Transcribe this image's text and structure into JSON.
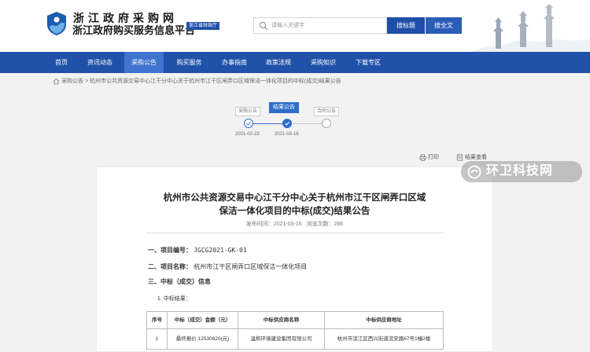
{
  "header": {
    "site_name": "浙江政府采购网",
    "site_subtitle": "浙江政府购买服务信息平台",
    "region_tag": "浙江省财政厅",
    "search_placeholder": "请输入关键字",
    "search_site_label": "搜标题",
    "search_all_label": "搜全文"
  },
  "nav": {
    "items": [
      "首页",
      "资讯动态",
      "采购公告",
      "购买服务",
      "办事指南",
      "政策法规",
      "采购知识",
      "下载专区"
    ],
    "active_index": 2
  },
  "breadcrumb": {
    "root": "采购公告",
    "separator": ">",
    "current": "杭州市公共资源交易中心江干分中心关于杭州市江干区闸弄口区域保洁一体化项目的中标(成交)结果公告"
  },
  "timeline": {
    "steps": [
      {
        "label": "采购公告",
        "date": "2021-02-23",
        "state": "done"
      },
      {
        "label": "结果公告",
        "date": "2021-03-16",
        "state": "current"
      },
      {
        "label": "合同公告",
        "date": "",
        "state": "todo"
      }
    ]
  },
  "tools": {
    "print": "打印",
    "view": "结果查看"
  },
  "article": {
    "title_line1": "杭州市公共资源交易中心江干分中心关于杭州市江干区闸弄口区域",
    "title_line2": "保洁一体化项目的中标(成交)结果公告",
    "publish_label": "发布时间：",
    "publish_date": "2021-03-16",
    "views_label": "浏览次数：",
    "views": "286",
    "sections": [
      {
        "num": "一、",
        "label": "项目编号：",
        "value": "JGCG2021-GK-01"
      },
      {
        "num": "二、",
        "label": "项目名称：",
        "value": "杭州市江干区闸弄口区域保洁一体化项目"
      },
      {
        "num": "三、",
        "label": "中标（成交）信息",
        "value": ""
      }
    ],
    "sub_item": "1. 中标结果：",
    "table": {
      "headers": [
        "序号",
        "中标（成交）金额（元）",
        "中标供应商名称",
        "中标供应商地址"
      ],
      "rows": [
        [
          "1",
          "最终报价:12530620(元)",
          "温和环境建设集团有限公司",
          "杭州市滨江区西兴街道滨安路67号1幢2楼"
        ]
      ]
    }
  },
  "watermark": {
    "text": "环卫科技网"
  },
  "colors": {
    "nav_bg": "#2152a9",
    "nav_active": "#3f74d0",
    "accent": "#2e6dc9"
  }
}
